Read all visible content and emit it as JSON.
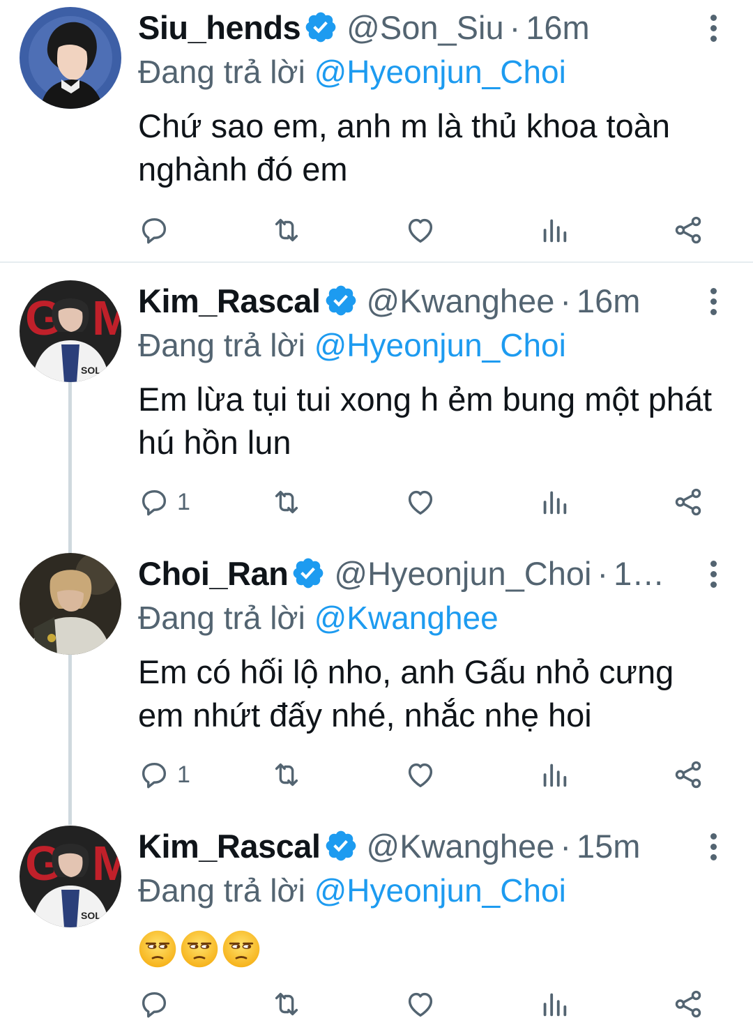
{
  "colors": {
    "accent": "#1d9bf0",
    "secondary_text": "#536471",
    "primary_text": "#0f1419",
    "divider": "#e6ecf0"
  },
  "tweets": [
    {
      "display_name": "Siu_hends",
      "handle": "@Son_Siu",
      "time": "16m",
      "replying_prefix": "Đang trả lời",
      "replying_to": "@Hyeonjun_Choi",
      "text": "Chứ sao em, anh m là thủ khoa toàn nghành đó em",
      "reply_count": ""
    },
    {
      "display_name": "Kim_Rascal",
      "handle": "@Kwanghee",
      "time": "16m",
      "replying_prefix": "Đang trả lời",
      "replying_to": "@Hyeonjun_Choi",
      "text": "Em lừa tụi tui xong h ẻm bung một phát hú hồn lun",
      "reply_count": "1"
    },
    {
      "display_name": "Choi_Ran",
      "handle": "@Hyeonjun_Choi",
      "time": "1…",
      "replying_prefix": "Đang trả lời",
      "replying_to": "@Kwanghee",
      "text": "Em có hối lộ nho, anh Gấu nhỏ cưng em nhứt đấy nhé, nhắc nhẹ hoi",
      "reply_count": "1"
    },
    {
      "display_name": "Kim_Rascal",
      "handle": "@Kwanghee",
      "time": "15m",
      "replying_prefix": "Đang trả lời",
      "replying_to": "@Hyeonjun_Choi",
      "text": "",
      "emoji": [
        "unamused-face-emoji",
        "unamused-face-emoji",
        "unamused-face-emoji"
      ],
      "reply_count": ""
    }
  ],
  "icons": {
    "reply": "reply-icon",
    "retweet": "retweet-icon",
    "like": "heart-icon",
    "views": "analytics-icon",
    "share": "share-icon",
    "more": "more-options-icon",
    "verified": "verified-badge-icon"
  }
}
